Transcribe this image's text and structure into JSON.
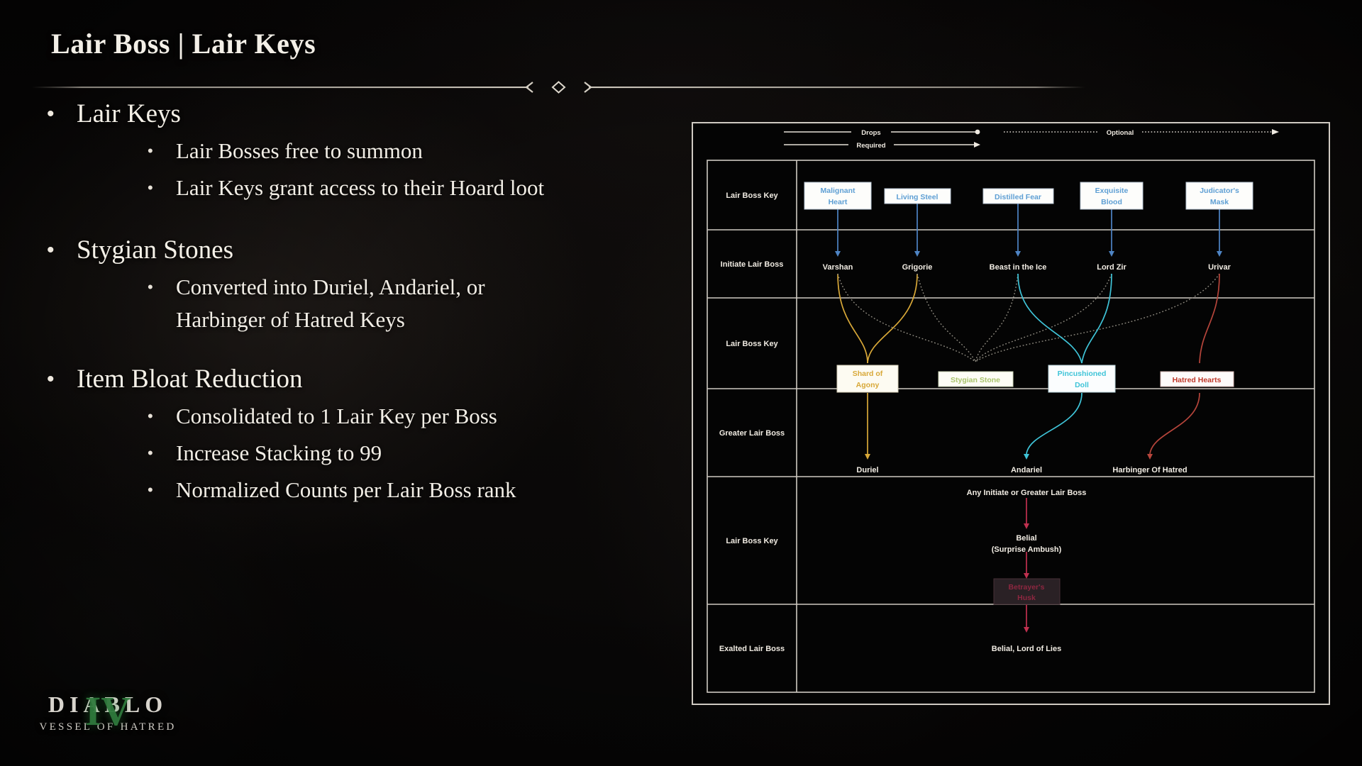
{
  "slide": {
    "title": "Lair Boss | Lair Keys",
    "divider_ornament": "diamond-chevron-ornament"
  },
  "bullets": [
    {
      "heading": "Lair Keys",
      "sub": [
        "Lair Bosses free to summon",
        "Lair Keys grant access to their Hoard loot"
      ]
    },
    {
      "heading": "Stygian Stones",
      "sub": [
        "Converted into Duriel, Andariel, or",
        "Harbinger of Hatred Keys"
      ]
    },
    {
      "heading": "Item Bloat Reduction",
      "sub": [
        "Consolidated to 1 Lair Key per Boss",
        "Increase Stacking to 99",
        "Normalized Counts per Lair Boss rank"
      ]
    }
  ],
  "diagram": {
    "legend": [
      {
        "label": "Drops",
        "style": "solid-line-dot-end"
      },
      {
        "label": "Required",
        "style": "solid-line-arrow-end"
      },
      {
        "label": "Optional",
        "style": "dotted-line-arrow-end"
      }
    ],
    "rows": [
      {
        "label": "Lair Boss Key"
      },
      {
        "label": "Initiate Lair Boss"
      },
      {
        "label": "Lair Boss Key"
      },
      {
        "label": "Greater Lair Boss"
      },
      {
        "label": "Lair Boss Key"
      },
      {
        "label": "Exalted Lair Boss"
      }
    ],
    "row1_keys": [
      {
        "label": "Malignant Heart",
        "color": "#5e9fd4"
      },
      {
        "label": "Living Steel",
        "color": "#5e9fd4"
      },
      {
        "label": "Distilled Fear",
        "color": "#5e9fd4"
      },
      {
        "label": "Exquisite Blood",
        "color": "#5e9fd4"
      },
      {
        "label": "Judicator's Mask",
        "color": "#5e9fd4"
      }
    ],
    "row2_bosses": [
      {
        "label": "Varshan"
      },
      {
        "label": "Grigorie"
      },
      {
        "label": "Beast in the Ice"
      },
      {
        "label": "Lord Zir"
      },
      {
        "label": "Urivar"
      }
    ],
    "row3_keys": [
      {
        "label": "Shard of Agony",
        "color": "#d8a838"
      },
      {
        "label": "Stygian Stone",
        "color": "#a9c46c"
      },
      {
        "label": "Pincushioned Doll",
        "color": "#3fc4d8"
      },
      {
        "label": "Hatred Hearts",
        "color": "#c0392b"
      }
    ],
    "row4_bosses": [
      {
        "label": "Duriel"
      },
      {
        "label": "Andariel"
      },
      {
        "label": "Harbinger Of Hatred"
      }
    ],
    "row5_belial": {
      "source": "Any Initiate or Greater Lair Boss",
      "drop_line1": "Belial",
      "drop_line2": "(Surprise Ambush)",
      "key_label_line1": "Betrayer's",
      "key_label_line2": "Husk",
      "key_color": "#c0304f"
    },
    "row6_boss": {
      "label": "Belial, Lord of Lies"
    }
  },
  "logo": {
    "title": "DIABLO",
    "numeral": "IV",
    "subtitle": "VESSEL OF HATRED",
    "numeral_color": "#2f7a3c"
  }
}
